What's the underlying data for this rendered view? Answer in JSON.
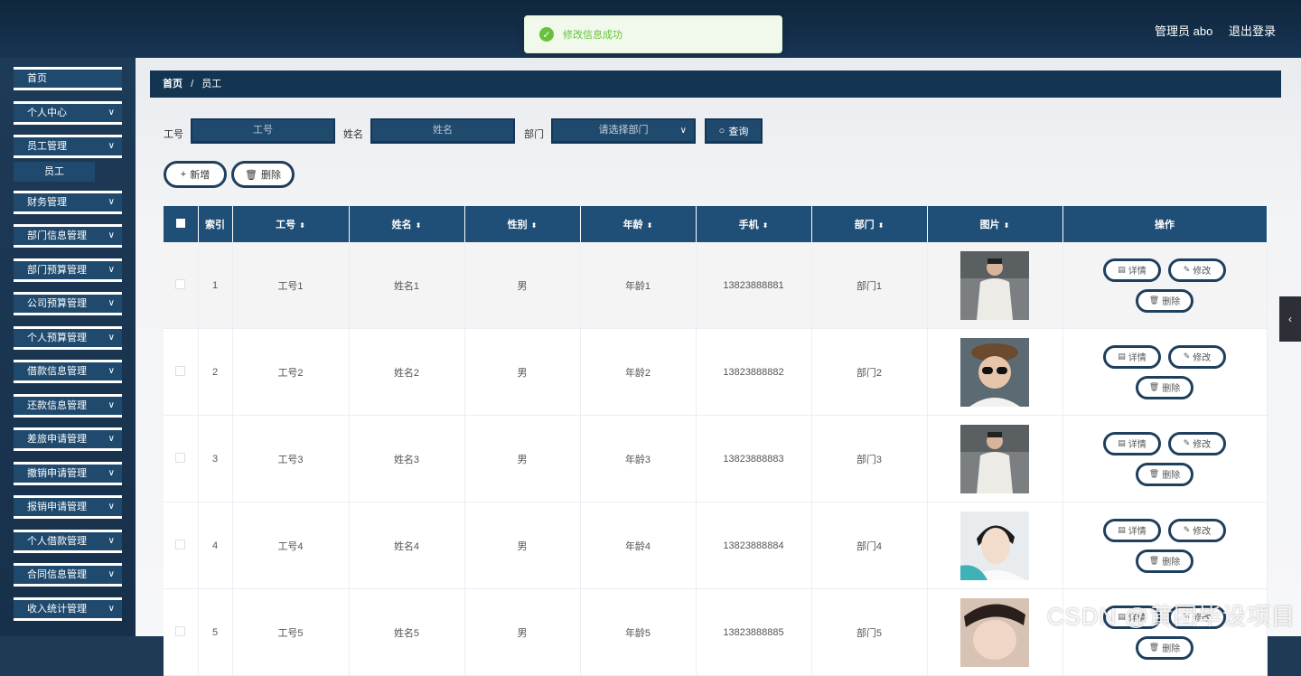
{
  "header": {
    "user_label": "管理员 abo",
    "logout_label": "退出登录"
  },
  "toast": {
    "message": "修改信息成功",
    "icon": "check-circle-icon"
  },
  "sidebar": {
    "items": [
      {
        "label": "首页",
        "has_arrow": false
      },
      {
        "label": "个人中心",
        "has_arrow": true
      },
      {
        "label": "员工管理",
        "has_arrow": true
      },
      {
        "label": "财务管理",
        "has_arrow": true
      },
      {
        "label": "部门信息管理",
        "has_arrow": true
      },
      {
        "label": "部门预算管理",
        "has_arrow": true
      },
      {
        "label": "公司预算管理",
        "has_arrow": true
      },
      {
        "label": "个人预算管理",
        "has_arrow": true
      },
      {
        "label": "借款信息管理",
        "has_arrow": true
      },
      {
        "label": "还款信息管理",
        "has_arrow": true
      },
      {
        "label": "差旅申请管理",
        "has_arrow": true
      },
      {
        "label": "撤销申请管理",
        "has_arrow": true
      },
      {
        "label": "报销申请管理",
        "has_arrow": true
      },
      {
        "label": "个人借款管理",
        "has_arrow": true
      },
      {
        "label": "合同信息管理",
        "has_arrow": true
      },
      {
        "label": "收入统计管理",
        "has_arrow": true
      }
    ],
    "sub_item": "员工"
  },
  "breadcrumb": {
    "home": "首页",
    "separator": "/",
    "current": "员工"
  },
  "filters": {
    "job_no_label": "工号",
    "job_no_placeholder": "工号",
    "name_label": "姓名",
    "name_placeholder": "姓名",
    "dept_label": "部门",
    "dept_placeholder": "请选择部门",
    "query_label": "查询"
  },
  "actions": {
    "add_label": "新增",
    "delete_label": "删除"
  },
  "table": {
    "columns": [
      "索引",
      "工号",
      "姓名",
      "性别",
      "年龄",
      "手机",
      "部门",
      "图片",
      "操作"
    ],
    "rows": [
      {
        "index": "1",
        "job_no": "工号1",
        "name": "姓名1",
        "gender": "男",
        "age": "年龄1",
        "phone": "13823888881",
        "dept": "部门1"
      },
      {
        "index": "2",
        "job_no": "工号2",
        "name": "姓名2",
        "gender": "男",
        "age": "年龄2",
        "phone": "13823888882",
        "dept": "部门2"
      },
      {
        "index": "3",
        "job_no": "工号3",
        "name": "姓名3",
        "gender": "男",
        "age": "年龄3",
        "phone": "13823888883",
        "dept": "部门3"
      },
      {
        "index": "4",
        "job_no": "工号4",
        "name": "姓名4",
        "gender": "男",
        "age": "年龄4",
        "phone": "13823888884",
        "dept": "部门4"
      },
      {
        "index": "5",
        "job_no": "工号5",
        "name": "姓名5",
        "gender": "男",
        "age": "年龄5",
        "phone": "13823888885",
        "dept": "部门5"
      }
    ],
    "op_labels": {
      "detail": "详情",
      "edit": "修改",
      "delete": "删除"
    }
  },
  "watermark": "CSDN @黄团毕设项目",
  "colors": {
    "accent": "#1f4a6e",
    "header": "#1f4f76",
    "success": "#67c23a"
  }
}
